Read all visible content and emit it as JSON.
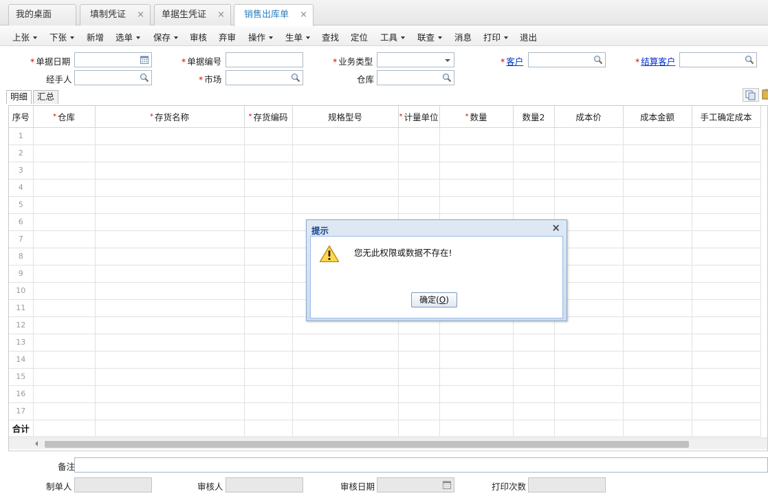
{
  "tabs": [
    {
      "label": "我的桌面",
      "closable": false,
      "active": false
    },
    {
      "label": "填制凭证",
      "closable": true,
      "active": false
    },
    {
      "label": "单据生凭证",
      "closable": true,
      "active": false
    },
    {
      "label": "销售出库单",
      "closable": true,
      "active": true
    }
  ],
  "tab_close_glyph": "×",
  "toolbar": [
    {
      "label": "上张",
      "dropdown": true
    },
    {
      "label": "下张",
      "dropdown": true
    },
    {
      "label": "新增",
      "dropdown": false
    },
    {
      "label": "选单",
      "dropdown": true
    },
    {
      "label": "保存",
      "dropdown": true
    },
    {
      "label": "审核",
      "dropdown": false
    },
    {
      "label": "弃审",
      "dropdown": false
    },
    {
      "label": "操作",
      "dropdown": true
    },
    {
      "label": "生单",
      "dropdown": true
    },
    {
      "label": "查找",
      "dropdown": false
    },
    {
      "label": "定位",
      "dropdown": false
    },
    {
      "label": "工具",
      "dropdown": true
    },
    {
      "label": "联查",
      "dropdown": true
    },
    {
      "label": "消息",
      "dropdown": false
    },
    {
      "label": "打印",
      "dropdown": true
    },
    {
      "label": "退出",
      "dropdown": false
    }
  ],
  "header": {
    "required_mark": "*",
    "bill_date": {
      "label": "单据日期",
      "value": ""
    },
    "bill_no": {
      "label": "单据编号",
      "value": ""
    },
    "biz_type": {
      "label": "业务类型",
      "value": ""
    },
    "customer": {
      "label": "客户",
      "value": ""
    },
    "settle_customer": {
      "label": "结算客户",
      "value": ""
    },
    "handler": {
      "label": "经手人",
      "value": ""
    },
    "market": {
      "label": "市场",
      "value": ""
    },
    "warehouse": {
      "label": "仓库",
      "value": ""
    }
  },
  "subtabs": [
    {
      "label": "明细",
      "active": true
    },
    {
      "label": "汇总",
      "active": false
    }
  ],
  "grid": {
    "columns": [
      {
        "label": "序号",
        "required": false
      },
      {
        "label": "仓库",
        "required": true
      },
      {
        "label": "存货名称",
        "required": true
      },
      {
        "label": "存货编码",
        "required": true
      },
      {
        "label": "规格型号",
        "required": false
      },
      {
        "label": "计量单位",
        "required": true
      },
      {
        "label": "数量",
        "required": true
      },
      {
        "label": "数量2",
        "required": false
      },
      {
        "label": "成本价",
        "required": false
      },
      {
        "label": "成本金额",
        "required": false
      },
      {
        "label": "手工确定成本",
        "required": false
      }
    ],
    "row_numbers": [
      "1",
      "2",
      "3",
      "4",
      "5",
      "6",
      "7",
      "8",
      "9",
      "10",
      "11",
      "12",
      "13",
      "14",
      "15",
      "16",
      "17"
    ],
    "total_label": "合计"
  },
  "footer": {
    "remark": {
      "label": "备注",
      "value": ""
    },
    "maker": {
      "label": "制单人",
      "value": ""
    },
    "auditor": {
      "label": "审核人",
      "value": ""
    },
    "audit_date": {
      "label": "审核日期",
      "value": ""
    },
    "print_count": {
      "label": "打印次数",
      "value": ""
    }
  },
  "dialog": {
    "title": "提示",
    "close_glyph": "×",
    "message": "您无此权限或数据不存在!",
    "ok_label": "确定",
    "ok_shortcut_open": "(",
    "ok_shortcut_key": "O",
    "ok_shortcut_close": ")",
    "icon": "warning-icon"
  },
  "colors": {
    "active_tab_text": "#2a7fc0",
    "required": "#dd0000",
    "link": "#0033cc",
    "dialog_title": "#15428b"
  }
}
